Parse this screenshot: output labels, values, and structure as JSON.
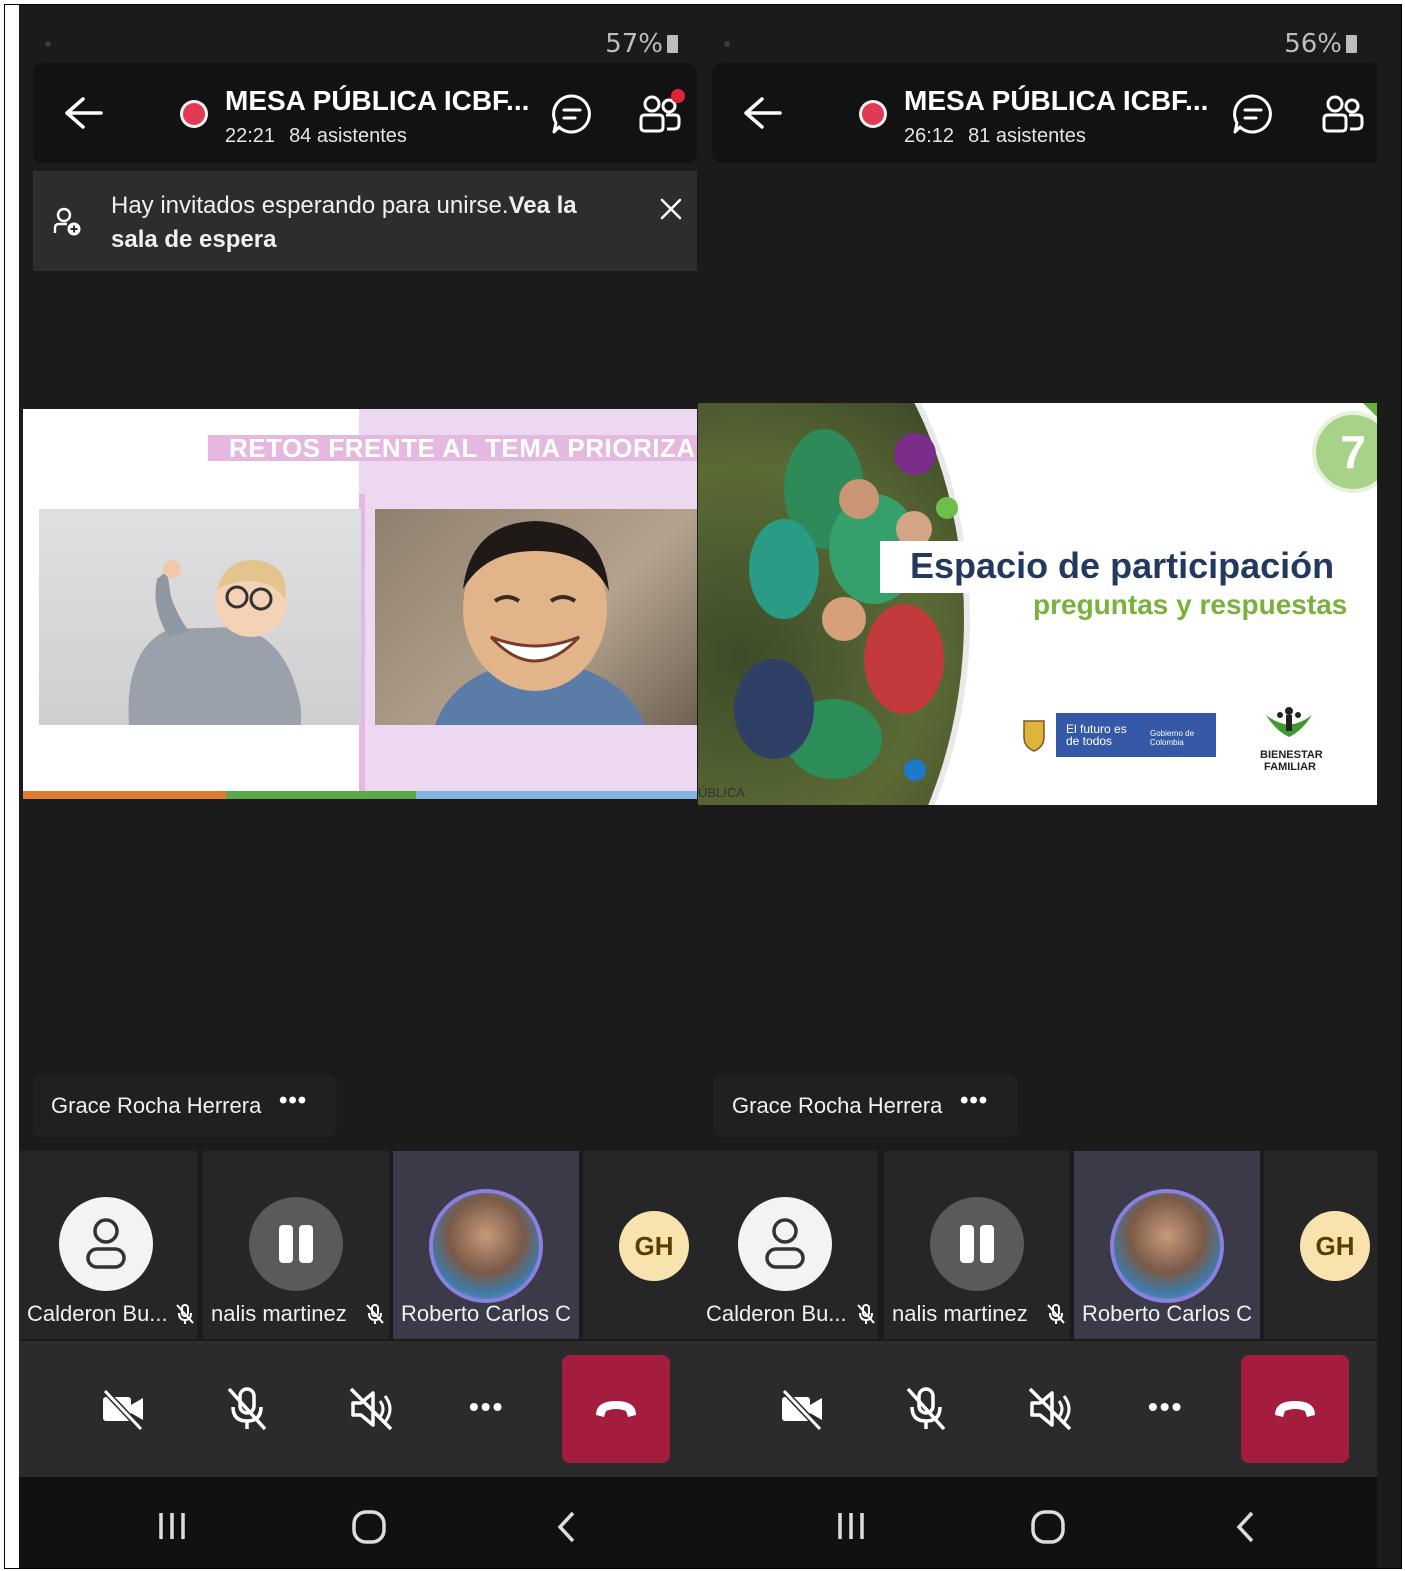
{
  "screens": [
    {
      "status": {
        "battery": "57%"
      },
      "header": {
        "title": "MESA PÚBLICA ICBF...",
        "time": "22:21",
        "attendees": "84 asistentes"
      },
      "has_notification_dot": true,
      "banner": {
        "text": "Hay invitados esperando para unirse.",
        "link": "Vea la sala de espera"
      },
      "slide": {
        "title": "RETOS FRENTE AL TEMA PRIORIZADO"
      },
      "presenter": {
        "name": "Grace Rocha Herrera",
        "more": "•••"
      },
      "participants": [
        {
          "name": "Calderon Bu...",
          "muted": true
        },
        {
          "name": "nalis martinez",
          "muted": true
        },
        {
          "name": "Roberto Carlos C",
          "muted": false
        },
        {
          "initials": "GH"
        }
      ],
      "controls": {
        "more": "•••"
      }
    },
    {
      "status": {
        "battery": "56%"
      },
      "header": {
        "title": "MESA PÚBLICA ICBF...",
        "time": "26:12",
        "attendees": "81 asistentes"
      },
      "has_notification_dot": false,
      "slide": {
        "number": "7",
        "title": "Espacio de participación",
        "subtitle": "preguntas y respuestas",
        "gov_text_1": "El futuro es de todos",
        "gov_text_2": "Gobierno de Colombia",
        "brand": "BIENESTAR FAMILIAR",
        "footer": "ÚBLICA"
      },
      "presenter": {
        "name": "Grace Rocha Herrera",
        "more": "•••"
      },
      "participants": [
        {
          "name": "Calderon Bu...",
          "muted": true
        },
        {
          "name": "nalis martinez",
          "muted": true
        },
        {
          "name": "Roberto Carlos C",
          "muted": false
        },
        {
          "initials": "GH"
        }
      ],
      "controls": {
        "more": "•••"
      }
    }
  ],
  "colors": {
    "record": "#e03b52",
    "hangup": "#a41c3e",
    "active_ring": "#8b7fe0",
    "gh_bg": "#f8e2ae"
  }
}
